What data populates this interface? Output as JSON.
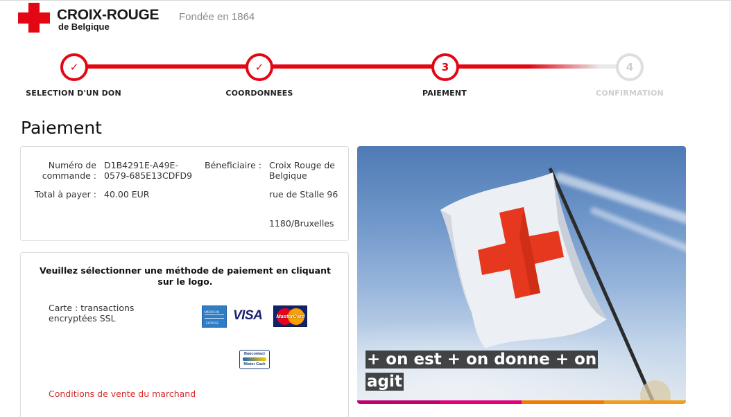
{
  "header": {
    "brand_name": "CROIX-ROUGE",
    "brand_sub": "de Belgique",
    "tagline": "Fondée en 1864",
    "logo_icon": "red-cross-icon"
  },
  "steps": [
    {
      "label": "SELECTION D'UN DON",
      "glyph": "✓",
      "state": "done"
    },
    {
      "label": "COORDONNEES",
      "glyph": "✓",
      "state": "done"
    },
    {
      "label": "PAIEMENT",
      "glyph": "3",
      "state": "active"
    },
    {
      "label": "CONFIRMATION",
      "glyph": "4",
      "state": "todo"
    }
  ],
  "page_title": "Paiement",
  "order": {
    "number_label": "Numéro de commande :",
    "number_value": "D1B4291E-A49E-0579-685E13CDFD9",
    "total_label": "Total à payer :",
    "total_value": "40.00 EUR",
    "beneficiary_label": "Béneficiaire :",
    "beneficiary_name": "Croix Rouge de Belgique",
    "beneficiary_street": "rue de Stalle 96",
    "beneficiary_city": "1180/Bruxelles"
  },
  "payment": {
    "instruction": "Veuillez sélectionner une méthode de paiement en cliquant sur le logo.",
    "card_text": "Carte : transactions encryptées SSL",
    "methods": [
      {
        "name": "American Express",
        "icon": "amex-logo"
      },
      {
        "name": "VISA",
        "icon": "visa-logo"
      },
      {
        "name": "MasterCard",
        "icon": "mastercard-logo"
      },
      {
        "name": "Bancontact Mister Cash",
        "icon": "bancontact-logo"
      }
    ],
    "visa_text": "VISA",
    "mc_text": "MasterCard",
    "amex_text_top": "AMERICAN",
    "amex_text_bottom": "EXPRESS",
    "bc_top": "Bancontact",
    "bc_bottom": "Mister Cash",
    "terms_link": "Conditions de vente du marchand"
  },
  "hero": {
    "caption": "+ on est + on donne + on agit",
    "bar_colors": [
      "#c0006e",
      "#e4007c",
      "#f07d00",
      "#f29e1d"
    ]
  },
  "colors": {
    "brand_red": "#e30613",
    "link_red": "#d42a2a",
    "step_inactive": "#cfcfcf"
  }
}
